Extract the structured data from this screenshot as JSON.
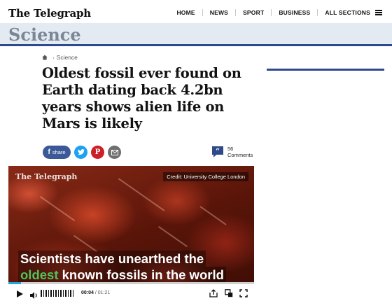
{
  "header": {
    "logo": "The Telegraph",
    "nav": [
      "HOME",
      "NEWS",
      "SPORT",
      "BUSINESS",
      "ALL SECTIONS"
    ]
  },
  "section": {
    "title": "Science"
  },
  "breadcrumb": {
    "items": [
      "Science"
    ]
  },
  "article": {
    "headline": "Oldest fossil ever found on Earth dating back 4.2bn years shows alien life on Mars is likely"
  },
  "share": {
    "facebook_label": "share",
    "comments_count": "56",
    "comments_label": "Comments"
  },
  "video": {
    "logo": "The Telegraph",
    "credit": "Credit: University College London",
    "subtitle_line1": "Scientists have unearthed the",
    "subtitle_highlight": "oldest",
    "subtitle_line2_rest": " known fossils in the world",
    "current_time": "00:04",
    "time_separator": " / ",
    "duration": "01:21",
    "progress_fraction": 0.05
  },
  "colors": {
    "brand_blue": "#2f4a8a",
    "facebook": "#3b5998",
    "twitter": "#1da1f2",
    "pinterest": "#cb2027",
    "email": "#6f6f6f",
    "progress": "#2aa2e0",
    "subtitle_highlight": "#4cc45b"
  }
}
